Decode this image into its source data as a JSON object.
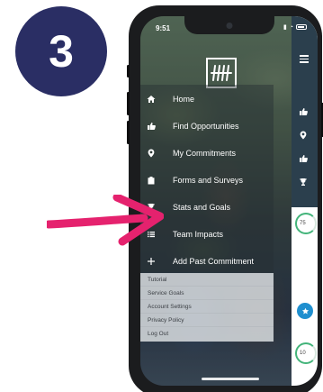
{
  "step": {
    "number": "3",
    "color": "#2a2e64"
  },
  "status_bar": {
    "time": "9:51"
  },
  "menu": {
    "items": [
      {
        "label": "Home",
        "icon": "home-icon"
      },
      {
        "label": "Find Opportunities",
        "icon": "thumbs-up-icon"
      },
      {
        "label": "My Commitments",
        "icon": "map-pin-icon"
      },
      {
        "label": "Forms and Surveys",
        "icon": "clipboard-icon"
      },
      {
        "label": "Stats and Goals",
        "icon": "trophy-icon"
      },
      {
        "label": "Team Impacts",
        "icon": "list-icon"
      },
      {
        "label": "Add Past Commitment",
        "icon": "plus-icon"
      }
    ]
  },
  "secondary_menu": {
    "items": [
      {
        "label": "Tutorial"
      },
      {
        "label": "Service Goals"
      },
      {
        "label": "Account Settings"
      },
      {
        "label": "Privacy Policy"
      },
      {
        "label": "Log Out"
      }
    ]
  },
  "background_content": {
    "progress_top": "75",
    "progress_bottom": "10",
    "header_color": "#2b3f4d",
    "progress_color": "#43b47a"
  },
  "annotation": {
    "arrow_color": "#e5226e"
  }
}
